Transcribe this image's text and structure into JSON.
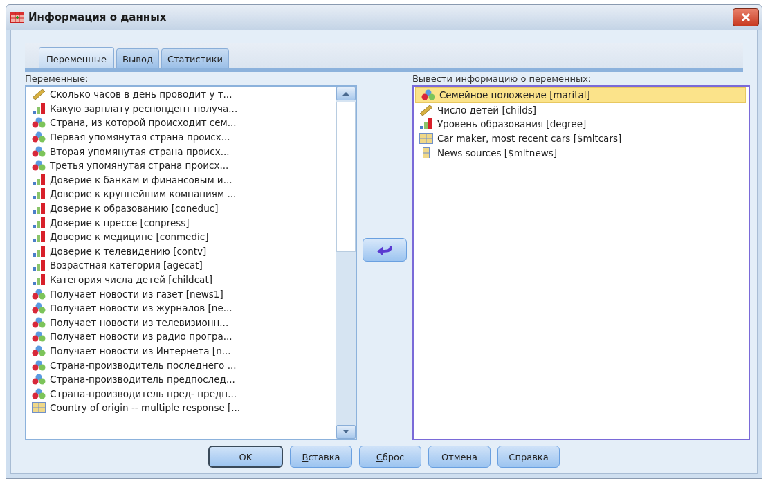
{
  "window": {
    "title": "Информация о данных"
  },
  "tabs": [
    {
      "label": "Переменные",
      "selected": true
    },
    {
      "label": "Вывод",
      "selected": false
    },
    {
      "label": "Статистики",
      "selected": false
    }
  ],
  "source": {
    "label": "Переменные:",
    "items": [
      {
        "text": "Сколько часов в день проводит у т...",
        "kind": "scale",
        "selected": false
      },
      {
        "text": "Какую зарплату респондент получа...",
        "kind": "ordinal",
        "selected": false
      },
      {
        "text": "Страна, из которой происходит сем...",
        "kind": "nominal",
        "selected": false
      },
      {
        "text": "Первая упомянутая страна происх...",
        "kind": "nominal",
        "selected": false
      },
      {
        "text": "Вторая упомянутая страна происх...",
        "kind": "nominal",
        "selected": false
      },
      {
        "text": "Третья упомянутая страна происх...",
        "kind": "nominal",
        "selected": false
      },
      {
        "text": "Доверие к банкам и финансовым и...",
        "kind": "ordinal",
        "selected": false
      },
      {
        "text": "Доверие к крупнейшим компаниям ...",
        "kind": "ordinal",
        "selected": false
      },
      {
        "text": "Доверие к образованию [coneduc]",
        "kind": "ordinal",
        "selected": false
      },
      {
        "text": "Доверие к прессе [conpress]",
        "kind": "ordinal",
        "selected": false
      },
      {
        "text": "Доверие к медицине [conmedic]",
        "kind": "ordinal",
        "selected": false
      },
      {
        "text": "Доверие к телевидению [contv]",
        "kind": "ordinal",
        "selected": false
      },
      {
        "text": "Возрастная категория [agecat]",
        "kind": "ordinal",
        "selected": false
      },
      {
        "text": "Категория числа детей [childcat]",
        "kind": "ordinal",
        "selected": false
      },
      {
        "text": "Получает новости из газет [news1]",
        "kind": "nominal",
        "selected": false
      },
      {
        "text": "Получает новости из журналов [ne...",
        "kind": "nominal",
        "selected": false
      },
      {
        "text": "Получает новости из телевизионн...",
        "kind": "nominal",
        "selected": false
      },
      {
        "text": "Получает новости из радио програ...",
        "kind": "nominal",
        "selected": false
      },
      {
        "text": "Получает новости из Интернета [n...",
        "kind": "nominal",
        "selected": false
      },
      {
        "text": "Страна-производитель последнего ...",
        "kind": "nominal",
        "selected": false
      },
      {
        "text": "Страна-производитель предпослед...",
        "kind": "nominal",
        "selected": false
      },
      {
        "text": "Страна-производитель пред- предп...",
        "kind": "nominal",
        "selected": false
      },
      {
        "text": "Country of origin -- multiple response [...",
        "kind": "multiset",
        "selected": false
      }
    ]
  },
  "target": {
    "label": "Вывести информацию о переменных:",
    "items": [
      {
        "text": "Семейное положение [marital]",
        "kind": "nominal",
        "selected": true
      },
      {
        "text": "Число детей [childs]",
        "kind": "scale",
        "selected": false
      },
      {
        "text": "Уровень образования [degree]",
        "kind": "ordinal",
        "selected": false
      },
      {
        "text": "Car maker, most recent cars [$mltcars]",
        "kind": "multiset",
        "selected": false
      },
      {
        "text": "News sources [$mltnews]",
        "kind": "dichotomy",
        "selected": false
      }
    ]
  },
  "buttons": [
    {
      "label": "OK",
      "default": true
    },
    {
      "label": "Вставка",
      "mnemonic": true,
      "default": false
    },
    {
      "label": "Сброс",
      "mnemonic": true,
      "default": false
    },
    {
      "label": "Отмена",
      "default": false
    },
    {
      "label": "Справка",
      "default": false
    }
  ]
}
